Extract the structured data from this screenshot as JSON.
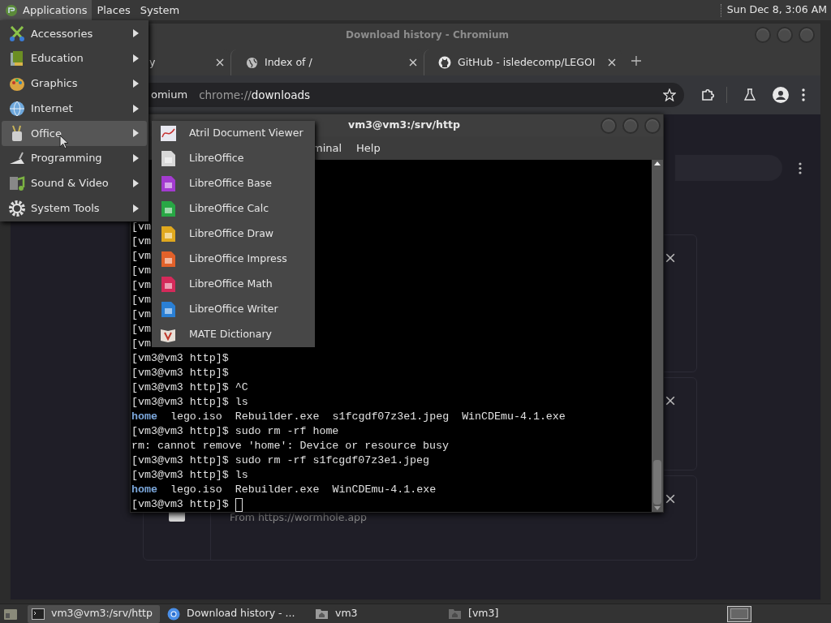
{
  "top_panel": {
    "menus": [
      {
        "label": "Applications",
        "selected": true
      },
      {
        "label": "Places",
        "selected": false
      },
      {
        "label": "System",
        "selected": false
      }
    ],
    "clock": "Sun Dec 8, 3:06 AM"
  },
  "applications_menu": {
    "items": [
      {
        "label": "Accessories",
        "selected": false
      },
      {
        "label": "Education",
        "selected": false
      },
      {
        "label": "Graphics",
        "selected": false
      },
      {
        "label": "Internet",
        "selected": false
      },
      {
        "label": "Office",
        "selected": true
      },
      {
        "label": "Programming",
        "selected": false
      },
      {
        "label": "Sound & Video",
        "selected": false
      },
      {
        "label": "System Tools",
        "selected": false
      }
    ]
  },
  "office_submenu": {
    "items": [
      {
        "label": "Atril Document Viewer",
        "kind": "viewer"
      },
      {
        "label": "LibreOffice",
        "kind": "document",
        "color": "#d8d8d8"
      },
      {
        "label": "LibreOffice Base",
        "kind": "document",
        "color": "#a33bd0"
      },
      {
        "label": "LibreOffice Calc",
        "kind": "document",
        "color": "#28a745"
      },
      {
        "label": "LibreOffice Draw",
        "kind": "document",
        "color": "#e0a81e"
      },
      {
        "label": "LibreOffice Impress",
        "kind": "document",
        "color": "#e2612a"
      },
      {
        "label": "LibreOffice Math",
        "kind": "document",
        "color": "#d42a5a"
      },
      {
        "label": "LibreOffice Writer",
        "kind": "document",
        "color": "#2a7fd4"
      },
      {
        "label": "MATE Dictionary",
        "kind": "book"
      }
    ]
  },
  "browser": {
    "title": "Download history - Chromium",
    "tabs": [
      {
        "title": "y"
      },
      {
        "title": "Index of /"
      },
      {
        "title": "GitHub - isledecomp/LEGOI"
      }
    ],
    "address": {
      "chip": "omium",
      "scheme": "chrome://",
      "path": "downloads"
    },
    "downloads": [
      {
        "kind": "covered"
      },
      {
        "kind": "covered"
      },
      {
        "kind": "file",
        "source": "From https://wormhole.app"
      }
    ]
  },
  "terminal": {
    "title": "vm3@vm3:/srv/http",
    "menus": [
      "minal",
      "Help"
    ],
    "lines": [
      {
        "kind": "text",
        "text": "[vm"
      },
      {
        "kind": "text",
        "text": "[vm"
      },
      {
        "kind": "text",
        "text": "[vm"
      },
      {
        "kind": "text",
        "text": "[vm"
      },
      {
        "kind": "text",
        "text": "[vm"
      },
      {
        "kind": "text",
        "text": "[vm"
      },
      {
        "kind": "text",
        "text": "[vm"
      },
      {
        "kind": "text",
        "text": "[vm"
      },
      {
        "kind": "text",
        "text": "[vm"
      },
      {
        "kind": "text",
        "text": "[vm3@vm3 http]$"
      },
      {
        "kind": "text",
        "text": "[vm3@vm3 http]$"
      },
      {
        "kind": "text",
        "text": "[vm3@vm3 http]$ ^C"
      },
      {
        "kind": "text",
        "text": "[vm3@vm3 http]$ ls"
      },
      {
        "kind": "listing",
        "entries": [
          {
            "name": "home",
            "kind": "dir"
          },
          {
            "name": "lego.iso",
            "kind": "file"
          },
          {
            "name": "Rebuilder.exe",
            "kind": "file"
          },
          {
            "name": "s1fcgdf07z3e1.jpeg",
            "kind": "file"
          },
          {
            "name": "WinCDEmu-4.1.exe",
            "kind": "file"
          }
        ]
      },
      {
        "kind": "text",
        "text": "[vm3@vm3 http]$ sudo rm -rf home"
      },
      {
        "kind": "text",
        "text": "rm: cannot remove 'home': Device or resource busy"
      },
      {
        "kind": "text",
        "text": "[vm3@vm3 http]$ sudo rm -rf s1fcgdf07z3e1.jpeg"
      },
      {
        "kind": "text",
        "text": "[vm3@vm3 http]$ ls"
      },
      {
        "kind": "listing",
        "entries": [
          {
            "name": "home",
            "kind": "dir"
          },
          {
            "name": "lego.iso",
            "kind": "file"
          },
          {
            "name": "Rebuilder.exe",
            "kind": "file"
          },
          {
            "name": "WinCDEmu-4.1.exe",
            "kind": "file"
          }
        ]
      },
      {
        "kind": "input",
        "text": "[vm3@vm3 http]$ "
      }
    ]
  },
  "taskbar": {
    "items": [
      {
        "label": "vm3@vm3:/srv/http",
        "selected": true
      },
      {
        "label": "Download history - ...",
        "selected": false
      },
      {
        "label": "vm3",
        "selected": false
      },
      {
        "label": "[vm3]",
        "selected": false
      }
    ]
  }
}
